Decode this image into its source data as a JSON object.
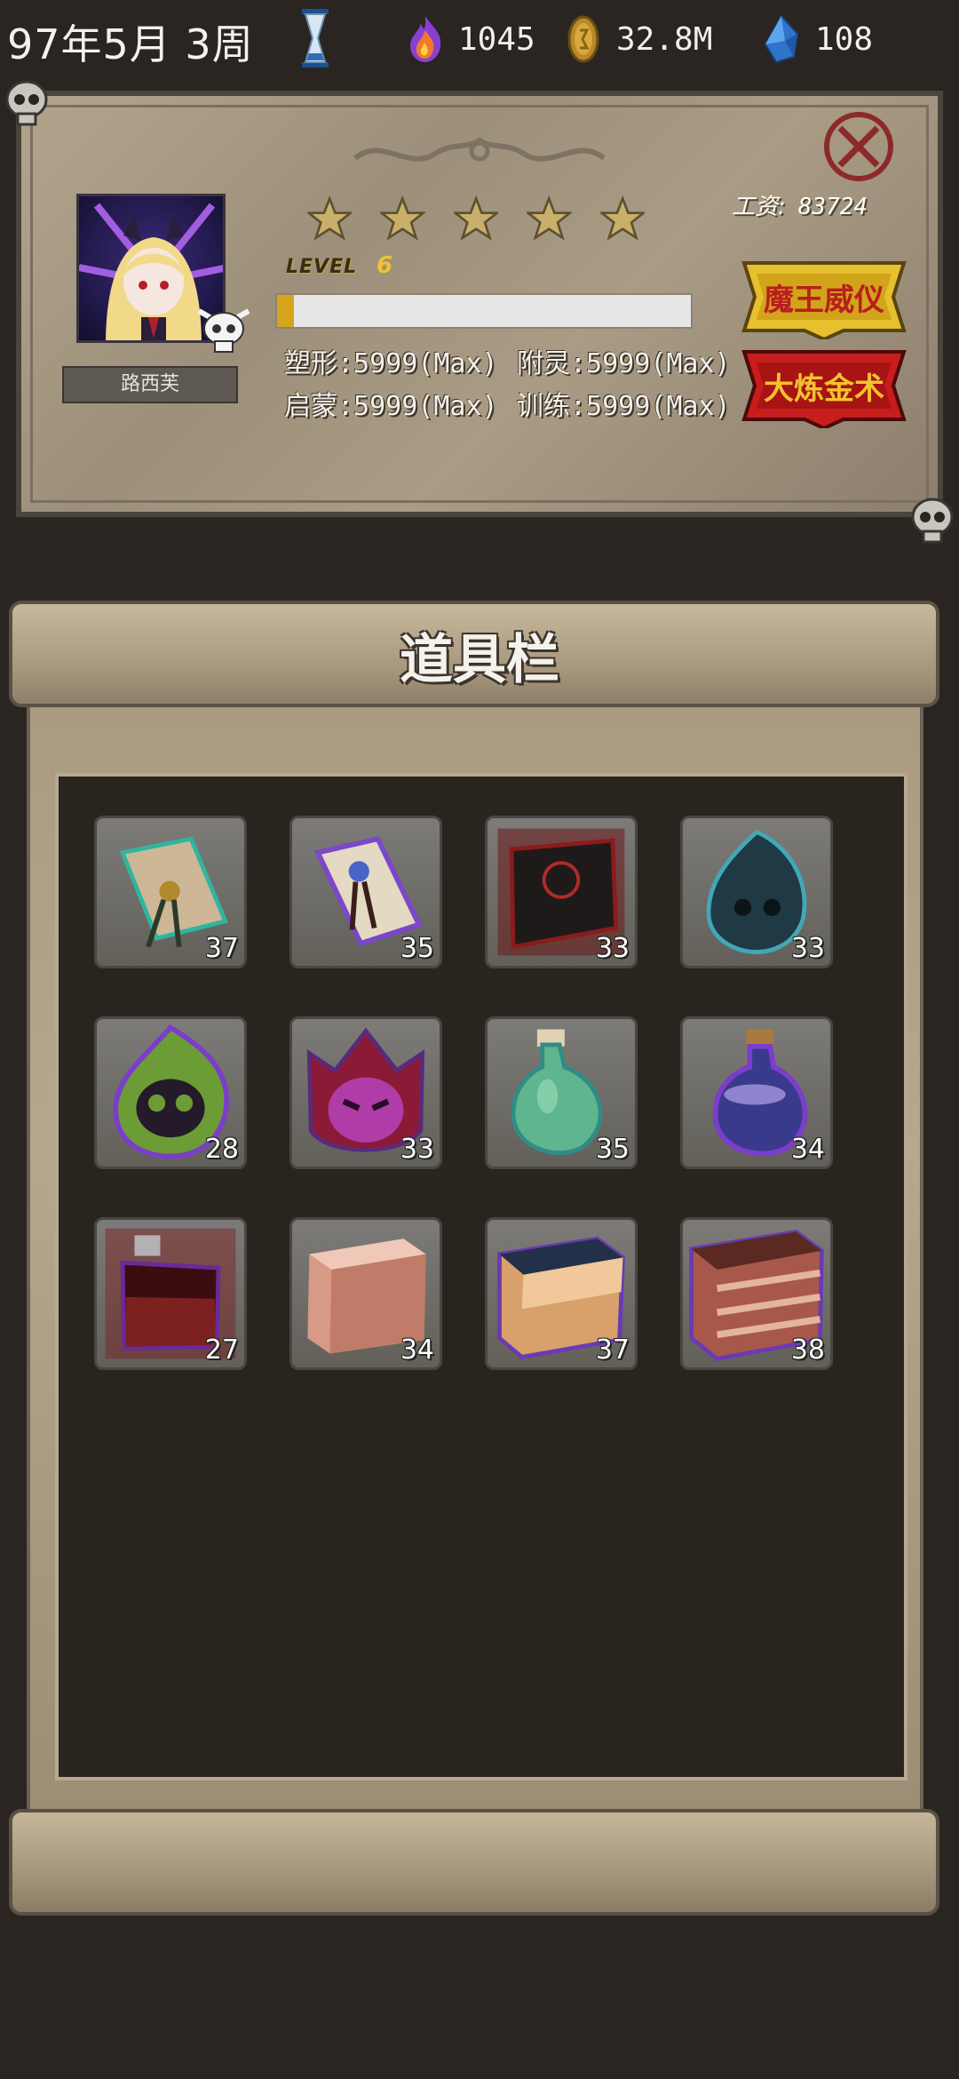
{
  "status_bar": {
    "date": "97年5月 3周",
    "souls": "1045",
    "gold": "32.8M",
    "crystals": "108"
  },
  "character": {
    "name": "路西芙",
    "stars": 5,
    "level_label": "LEVEL",
    "level": "6",
    "exp_progress": 0.04,
    "salary_label": "工资:",
    "salary": "83724",
    "stats": [
      {
        "label": "塑形",
        "value": ":5999(Max)"
      },
      {
        "label": "附灵",
        "value": ":5999(Max)"
      },
      {
        "label": "启蒙",
        "value": ":5999(Max)"
      },
      {
        "label": "训练",
        "value": ":5999(Max)"
      }
    ],
    "buttons": {
      "majesty": "魔王威仪",
      "alchemy": "大炼金术"
    }
  },
  "inventory": {
    "title": "道具栏",
    "items": [
      {
        "icon": "tan-scroll-icon",
        "qty": "37"
      },
      {
        "icon": "purple-scroll-icon",
        "qty": "35"
      },
      {
        "icon": "dark-tome-icon",
        "qty": "33"
      },
      {
        "icon": "teal-ghost-icon",
        "qty": "33"
      },
      {
        "icon": "green-skull-flame-icon",
        "qty": "28"
      },
      {
        "icon": "magenta-skull-flame-icon",
        "qty": "33"
      },
      {
        "icon": "green-potion-icon",
        "qty": "35"
      },
      {
        "icon": "purple-potion-icon",
        "qty": "34"
      },
      {
        "icon": "red-potion-icon",
        "qty": "27"
      },
      {
        "icon": "pink-meat-block-icon",
        "qty": "34"
      },
      {
        "icon": "cake-block-icon",
        "qty": "37"
      },
      {
        "icon": "layered-meat-block-icon",
        "qty": "38"
      }
    ]
  },
  "colors": {
    "gold_button": "#e6c02e",
    "red_button": "#c71d1d",
    "exp_fill": "#d8a41c"
  }
}
